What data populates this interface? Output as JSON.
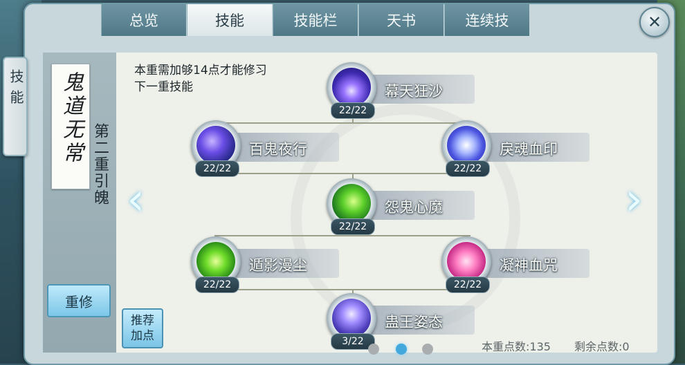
{
  "side_tab": {
    "label": "技能"
  },
  "tabs": [
    {
      "label": "总览",
      "active": false
    },
    {
      "label": "技能",
      "active": true
    },
    {
      "label": "技能栏",
      "active": false
    },
    {
      "label": "天书",
      "active": false
    },
    {
      "label": "连续技",
      "active": false
    }
  ],
  "close_symbol": "✕",
  "school": {
    "name": "鬼道无常",
    "tier": "第二重引魄"
  },
  "tip": "本重需加够14点才能修习下一重技能",
  "skills": [
    {
      "name": "幕天狂沙",
      "level": "22/22",
      "icon": "purple-beam-icon"
    },
    {
      "name": "百鬼夜行",
      "level": "22/22",
      "icon": "purple-storm-icon"
    },
    {
      "name": "戾魂血印",
      "level": "22/22",
      "icon": "blue-seal-icon"
    },
    {
      "name": "怨鬼心魔",
      "level": "22/22",
      "icon": "green-ghost-icon"
    },
    {
      "name": "遁影漫尘",
      "level": "22/22",
      "icon": "green-shield-icon"
    },
    {
      "name": "凝神血咒",
      "level": "22/22",
      "icon": "pink-shield-icon"
    },
    {
      "name": "蛊王姿态",
      "level": "3/22",
      "icon": "purple-figure-icon"
    }
  ],
  "buttons": {
    "reset": "重修",
    "recommend_line1": "推荐",
    "recommend_line2": "加点"
  },
  "arrows": {
    "prev": "‹",
    "next": "›"
  },
  "pager": {
    "count": 3,
    "active": 2
  },
  "points": {
    "tier_label": "本重点数:",
    "tier_value": "135",
    "remaining_label": "剩余点数:",
    "remaining_value": "0"
  },
  "colors": {
    "accent": "#43a9dc",
    "tab_active": "#f5f8f8",
    "tab_inactive": "#5f8795"
  }
}
